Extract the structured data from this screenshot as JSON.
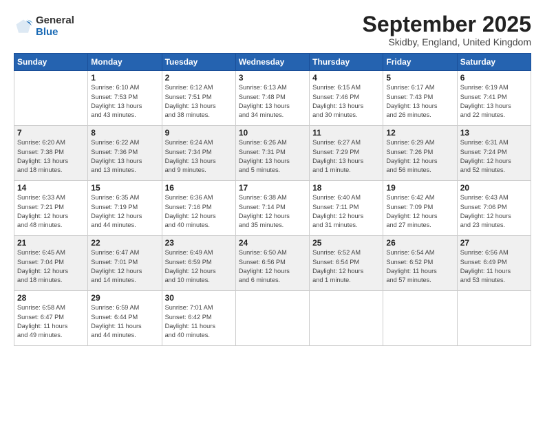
{
  "logo": {
    "general": "General",
    "blue": "Blue"
  },
  "title": "September 2025",
  "location": "Skidby, England, United Kingdom",
  "headers": [
    "Sunday",
    "Monday",
    "Tuesday",
    "Wednesday",
    "Thursday",
    "Friday",
    "Saturday"
  ],
  "weeks": [
    [
      {
        "day": "",
        "info": ""
      },
      {
        "day": "1",
        "info": "Sunrise: 6:10 AM\nSunset: 7:53 PM\nDaylight: 13 hours\nand 43 minutes."
      },
      {
        "day": "2",
        "info": "Sunrise: 6:12 AM\nSunset: 7:51 PM\nDaylight: 13 hours\nand 38 minutes."
      },
      {
        "day": "3",
        "info": "Sunrise: 6:13 AM\nSunset: 7:48 PM\nDaylight: 13 hours\nand 34 minutes."
      },
      {
        "day": "4",
        "info": "Sunrise: 6:15 AM\nSunset: 7:46 PM\nDaylight: 13 hours\nand 30 minutes."
      },
      {
        "day": "5",
        "info": "Sunrise: 6:17 AM\nSunset: 7:43 PM\nDaylight: 13 hours\nand 26 minutes."
      },
      {
        "day": "6",
        "info": "Sunrise: 6:19 AM\nSunset: 7:41 PM\nDaylight: 13 hours\nand 22 minutes."
      }
    ],
    [
      {
        "day": "7",
        "info": "Sunrise: 6:20 AM\nSunset: 7:38 PM\nDaylight: 13 hours\nand 18 minutes."
      },
      {
        "day": "8",
        "info": "Sunrise: 6:22 AM\nSunset: 7:36 PM\nDaylight: 13 hours\nand 13 minutes."
      },
      {
        "day": "9",
        "info": "Sunrise: 6:24 AM\nSunset: 7:34 PM\nDaylight: 13 hours\nand 9 minutes."
      },
      {
        "day": "10",
        "info": "Sunrise: 6:26 AM\nSunset: 7:31 PM\nDaylight: 13 hours\nand 5 minutes."
      },
      {
        "day": "11",
        "info": "Sunrise: 6:27 AM\nSunset: 7:29 PM\nDaylight: 13 hours\nand 1 minute."
      },
      {
        "day": "12",
        "info": "Sunrise: 6:29 AM\nSunset: 7:26 PM\nDaylight: 12 hours\nand 56 minutes."
      },
      {
        "day": "13",
        "info": "Sunrise: 6:31 AM\nSunset: 7:24 PM\nDaylight: 12 hours\nand 52 minutes."
      }
    ],
    [
      {
        "day": "14",
        "info": "Sunrise: 6:33 AM\nSunset: 7:21 PM\nDaylight: 12 hours\nand 48 minutes."
      },
      {
        "day": "15",
        "info": "Sunrise: 6:35 AM\nSunset: 7:19 PM\nDaylight: 12 hours\nand 44 minutes."
      },
      {
        "day": "16",
        "info": "Sunrise: 6:36 AM\nSunset: 7:16 PM\nDaylight: 12 hours\nand 40 minutes."
      },
      {
        "day": "17",
        "info": "Sunrise: 6:38 AM\nSunset: 7:14 PM\nDaylight: 12 hours\nand 35 minutes."
      },
      {
        "day": "18",
        "info": "Sunrise: 6:40 AM\nSunset: 7:11 PM\nDaylight: 12 hours\nand 31 minutes."
      },
      {
        "day": "19",
        "info": "Sunrise: 6:42 AM\nSunset: 7:09 PM\nDaylight: 12 hours\nand 27 minutes."
      },
      {
        "day": "20",
        "info": "Sunrise: 6:43 AM\nSunset: 7:06 PM\nDaylight: 12 hours\nand 23 minutes."
      }
    ],
    [
      {
        "day": "21",
        "info": "Sunrise: 6:45 AM\nSunset: 7:04 PM\nDaylight: 12 hours\nand 18 minutes."
      },
      {
        "day": "22",
        "info": "Sunrise: 6:47 AM\nSunset: 7:01 PM\nDaylight: 12 hours\nand 14 minutes."
      },
      {
        "day": "23",
        "info": "Sunrise: 6:49 AM\nSunset: 6:59 PM\nDaylight: 12 hours\nand 10 minutes."
      },
      {
        "day": "24",
        "info": "Sunrise: 6:50 AM\nSunset: 6:56 PM\nDaylight: 12 hours\nand 6 minutes."
      },
      {
        "day": "25",
        "info": "Sunrise: 6:52 AM\nSunset: 6:54 PM\nDaylight: 12 hours\nand 1 minute."
      },
      {
        "day": "26",
        "info": "Sunrise: 6:54 AM\nSunset: 6:52 PM\nDaylight: 11 hours\nand 57 minutes."
      },
      {
        "day": "27",
        "info": "Sunrise: 6:56 AM\nSunset: 6:49 PM\nDaylight: 11 hours\nand 53 minutes."
      }
    ],
    [
      {
        "day": "28",
        "info": "Sunrise: 6:58 AM\nSunset: 6:47 PM\nDaylight: 11 hours\nand 49 minutes."
      },
      {
        "day": "29",
        "info": "Sunrise: 6:59 AM\nSunset: 6:44 PM\nDaylight: 11 hours\nand 44 minutes."
      },
      {
        "day": "30",
        "info": "Sunrise: 7:01 AM\nSunset: 6:42 PM\nDaylight: 11 hours\nand 40 minutes."
      },
      {
        "day": "",
        "info": ""
      },
      {
        "day": "",
        "info": ""
      },
      {
        "day": "",
        "info": ""
      },
      {
        "day": "",
        "info": ""
      }
    ]
  ]
}
